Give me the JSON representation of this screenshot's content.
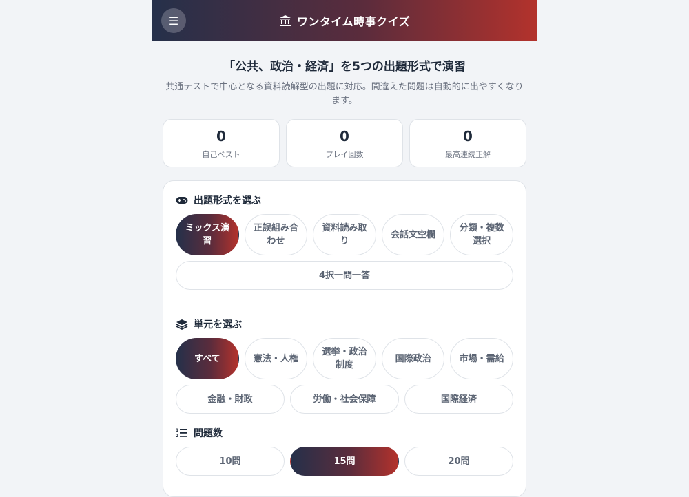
{
  "header": {
    "title": "ワンタイム時事クイズ",
    "menu_icon": "menu-icon",
    "title_icon": "bank-icon"
  },
  "intro": {
    "heading": "「公共、政治・経済」を5つの出題形式で演習",
    "description": "共通テストで中心となる資料読解型の出題に対応。間違えた問題は自動的に出やすくなります。"
  },
  "stats": [
    {
      "value": "0",
      "label": "自己ベスト"
    },
    {
      "value": "0",
      "label": "プレイ回数"
    },
    {
      "value": "0",
      "label": "最高連続正解"
    }
  ],
  "format_section": {
    "title": "出題形式を選ぶ",
    "icon": "gamepad-icon",
    "options": [
      "ミックス演習",
      "正誤組み合わせ",
      "資料読み取り",
      "会話文空欄",
      "分類・複数選択"
    ],
    "wide_option": "4択一問一答",
    "selected": "ミックス演習"
  },
  "unit_section": {
    "title": "単元を選ぶ",
    "icon": "layers-icon",
    "options_row1": [
      "すべて",
      "憲法・人権",
      "選挙・政治制度",
      "国際政治",
      "市場・需給"
    ],
    "options_row2": [
      "金融・財政",
      "労働・社会保障",
      "国際経済"
    ],
    "selected": "すべて"
  },
  "count_section": {
    "title": "問題数",
    "icon": "list-ordered-icon",
    "options": [
      "10問",
      "15問",
      "20問"
    ],
    "selected": "15問"
  },
  "colors": {
    "gradient_start": "#25304a",
    "gradient_end": "#b3322c",
    "background": "#f2f4f7"
  }
}
